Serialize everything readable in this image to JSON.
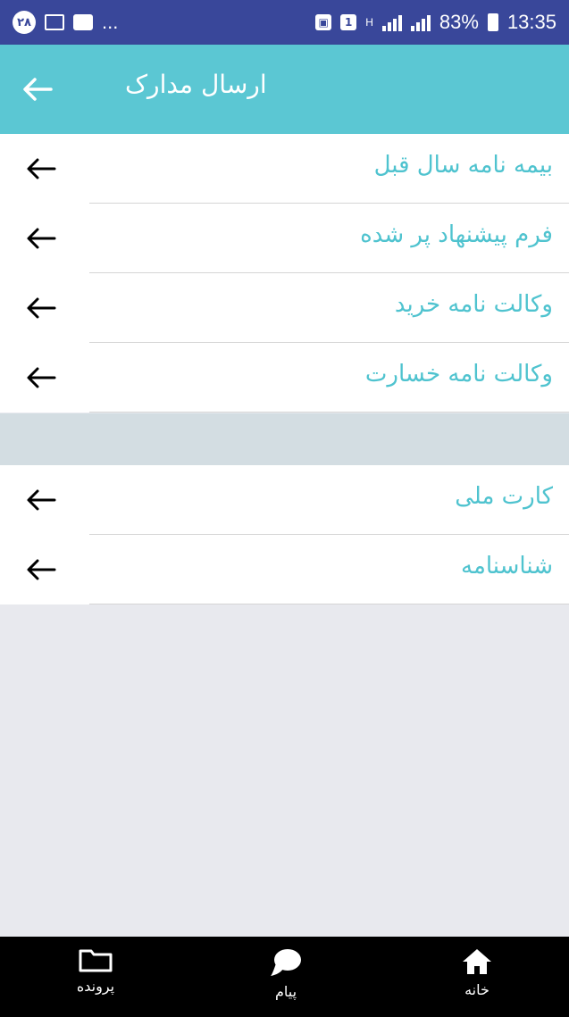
{
  "status_bar": {
    "date_badge": "۲۸",
    "dots": "...",
    "battery": "83%",
    "time": "13:35",
    "network_h": "H"
  },
  "app_bar": {
    "title": "ارسال مدارک",
    "back_icon": "arrow-left-icon",
    "background": "#5bc7d3"
  },
  "documents_group_1": [
    {
      "label": "بیمه نامه سال قبل"
    },
    {
      "label": "فرم پیشنهاد پر شده"
    },
    {
      "label": "وکالت نامه خرید"
    },
    {
      "label": "وکالت نامه خسارت"
    }
  ],
  "documents_group_2": [
    {
      "label": "کارت ملی"
    },
    {
      "label": "شناسنامه"
    }
  ],
  "bottom_nav": {
    "items": [
      {
        "label": "پرونده",
        "icon": "folder-icon"
      },
      {
        "label": "پیام",
        "icon": "chat-icon"
      },
      {
        "label": "خانه",
        "icon": "home-icon"
      }
    ]
  },
  "colors": {
    "status_bar": "#39479a",
    "accent": "#5bc7d3",
    "item_text": "#4fc3cf",
    "nav_bg": "#000000",
    "page_bg": "#e8e9ee"
  }
}
